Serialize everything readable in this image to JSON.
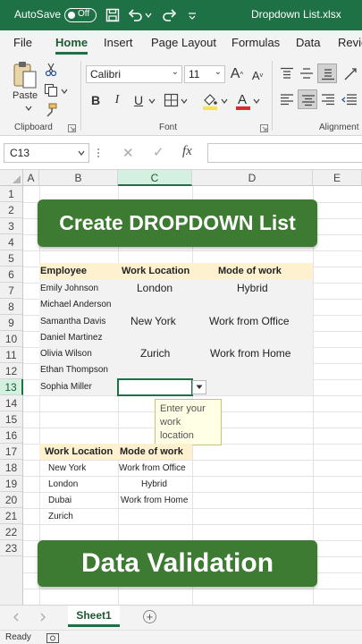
{
  "titlebar": {
    "autosave_label": "AutoSave",
    "autosave_state": "Off",
    "filename": "Dropdown List.xlsx",
    "bg_color": "#1e7145"
  },
  "menu": {
    "tabs": [
      "File",
      "Home",
      "Insert",
      "Page Layout",
      "Formulas",
      "Data",
      "Revie"
    ],
    "active": "Home"
  },
  "ribbon": {
    "clipboard": {
      "paste_label": "Paste",
      "group_label": "Clipboard"
    },
    "font": {
      "font_name": "Calibri",
      "font_size": "11",
      "group_label": "Font",
      "bold": "B",
      "italic": "I",
      "underline": "U",
      "grow": "A",
      "shrink": "A"
    },
    "alignment": {
      "group_label": "Alignment"
    }
  },
  "formula_bar": {
    "name_box": "C13",
    "fx_label": "fx",
    "cancel_glyph": "✕",
    "enter_glyph": "✓",
    "value": ""
  },
  "grid": {
    "columns": [
      "A",
      "B",
      "C",
      "D",
      "E"
    ],
    "selected_column": "C",
    "rows": [
      "1",
      "2",
      "3",
      "4",
      "5",
      "6",
      "7",
      "8",
      "9",
      "10",
      "11",
      "12",
      "13",
      "14",
      "15",
      "16",
      "17",
      "18",
      "19",
      "20",
      "21",
      "22",
      "23"
    ],
    "selected_row": "13"
  },
  "banner_top": {
    "text": "Create DROPDOWN List",
    "color": "#3e7b32"
  },
  "banner_bottom": {
    "text": "Data Validation",
    "color": "#3e7b32"
  },
  "main_table": {
    "headers": [
      "Employee",
      "Work Location",
      "Mode of work"
    ],
    "rows": [
      [
        "Emily Johnson",
        "London",
        "Hybrid"
      ],
      [
        "Michael Anderson",
        "",
        ""
      ],
      [
        "Samantha Davis",
        "New York",
        "Work from Office"
      ],
      [
        "Daniel Martinez",
        "",
        ""
      ],
      [
        "Olivia Wilson",
        "Zurich",
        "Work from Home"
      ],
      [
        "Ethan Thompson",
        "",
        ""
      ],
      [
        "Sophia Miller",
        "",
        ""
      ]
    ]
  },
  "tooltip": {
    "lines": [
      "Enter your",
      "work",
      "location"
    ]
  },
  "lookup_table": {
    "headers": [
      "Work Location",
      "Mode of work"
    ],
    "rows": [
      [
        "New York",
        "Work from Office"
      ],
      [
        "London",
        "Hybrid"
      ],
      [
        "Dubai",
        "Work from Home"
      ],
      [
        "Zurich",
        ""
      ]
    ]
  },
  "sheets": {
    "active": "Sheet1",
    "add_glyph": "+"
  },
  "status": {
    "text": "Ready"
  }
}
